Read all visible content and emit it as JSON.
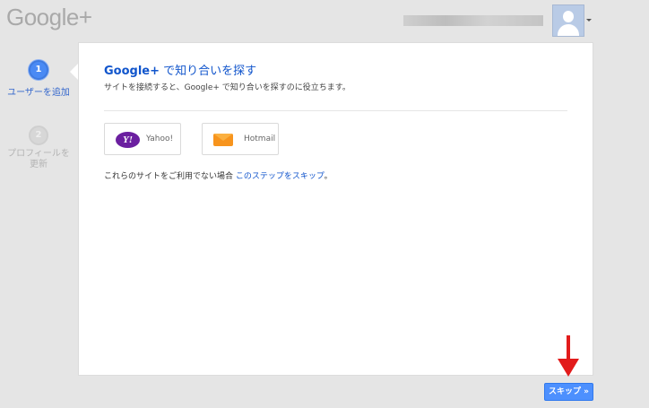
{
  "header": {
    "logo_text": "Google+",
    "account_email": ""
  },
  "steps": [
    {
      "number": "1",
      "label": "ユーザーを追加",
      "state": "active"
    },
    {
      "number": "2",
      "label": "プロフィールを更新",
      "state": "inactive"
    }
  ],
  "card": {
    "title_brand": "Google+",
    "title_rest": " で知り合いを探す",
    "subtitle": "サイトを接続すると、Google+ で知り合いを探すのに役立ちます。",
    "providers": [
      {
        "name": "Yahoo!",
        "icon": "yahoo-logo-icon"
      },
      {
        "name": "Hotmail",
        "icon": "hotmail-envelope-icon"
      }
    ],
    "skip_prefix": "これらのサイトをご利用でない場合",
    "skip_link": "このステップをスキップ",
    "skip_suffix": "。"
  },
  "footer": {
    "skip_button": "スキップ »"
  },
  "colors": {
    "accent_blue": "#4d90fe",
    "link_blue": "#1155cc",
    "annotation_red": "#e21b1b"
  }
}
